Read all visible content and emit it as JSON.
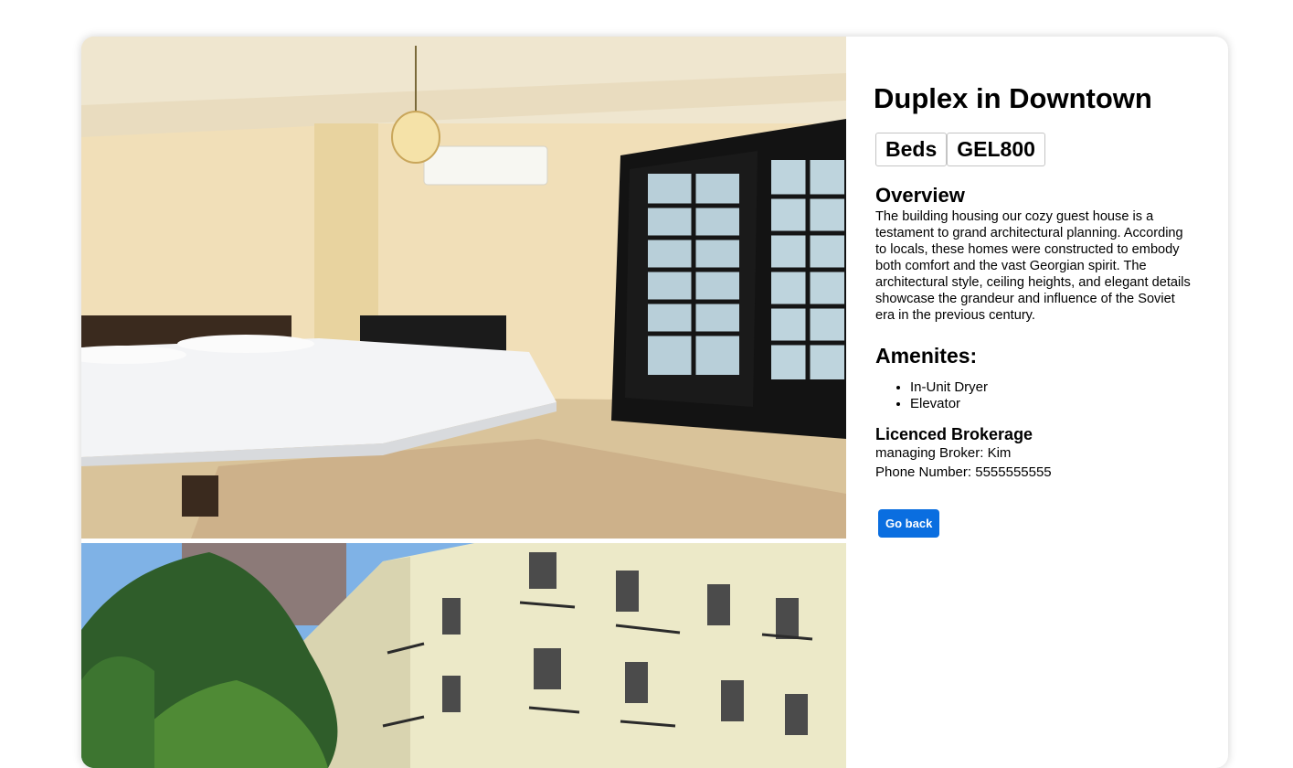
{
  "listing": {
    "title": "Duplex in Downtown",
    "badges": {
      "beds": "Beds",
      "price": "GEL800"
    },
    "overview_heading": "Overview",
    "overview_text": "The building housing our cozy guest house is a testament to grand architectural planning. According to locals, these homes were constructed to embody both comfort and the vast Georgian spirit. The architectural style, ceiling heights, and elegant details showcase the grandeur and influence of the Soviet era in the previous century.",
    "amenities_heading": "Amenites:",
    "amenities": [
      "In-Unit Dryer",
      "Elevator"
    ],
    "brokerage_heading": "Licenced Brokerage",
    "broker_line": "managing Broker: Kim",
    "phone_line": "Phone Number: 5555555555",
    "back_button": "Go back"
  },
  "colors": {
    "button": "#0a6ee0",
    "button_text": "#ffffff"
  }
}
